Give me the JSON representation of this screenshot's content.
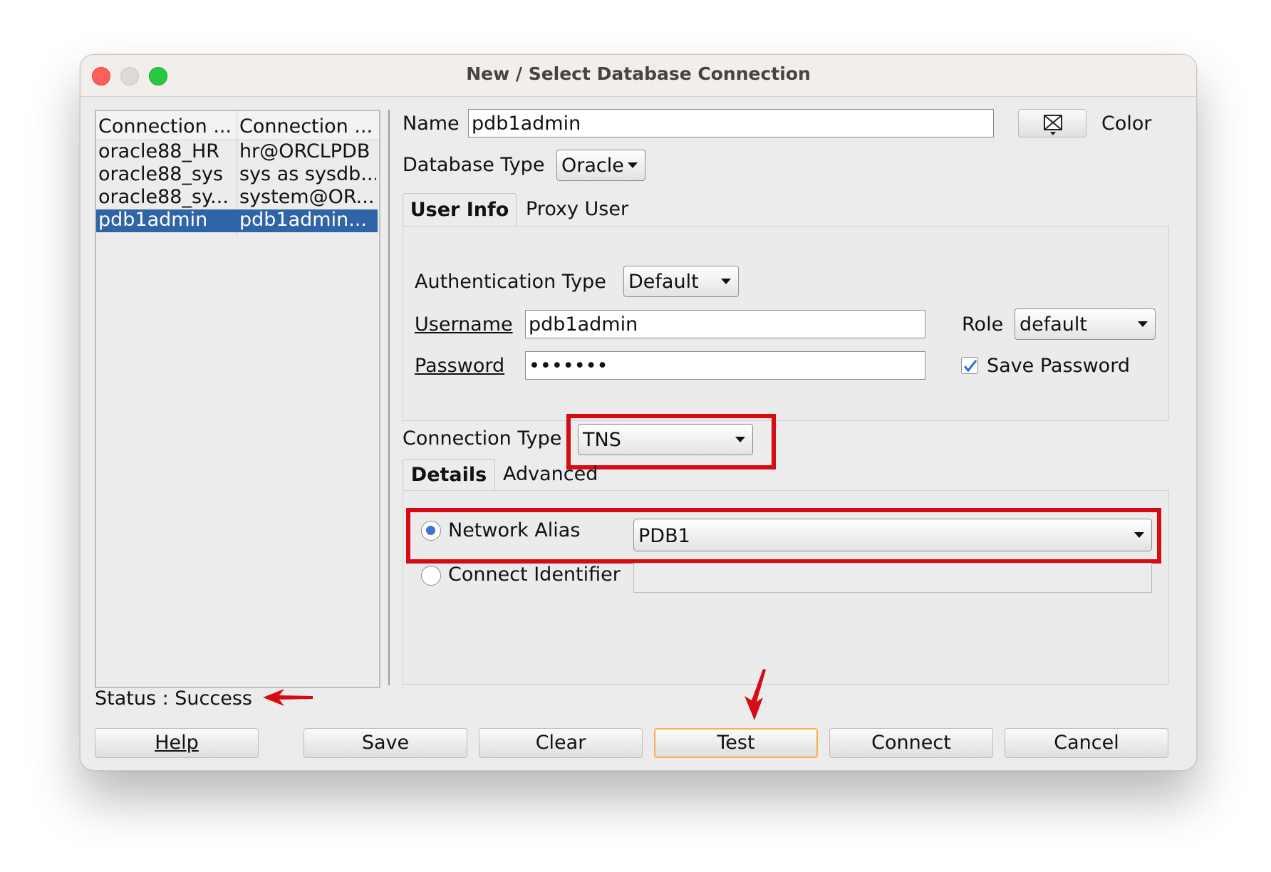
{
  "window": {
    "title": "New / Select Database Connection"
  },
  "connections": {
    "columns": [
      "Connection ...",
      "Connection ..."
    ],
    "rows": [
      {
        "name": "oracle88_HR",
        "details": "hr@ORCLPDB"
      },
      {
        "name": "oracle88_sys",
        "details": "sys as sysdb..."
      },
      {
        "name": "oracle88_sy...",
        "details": "system@OR..."
      },
      {
        "name": "pdb1admin",
        "details": "pdb1admin...",
        "selected": true
      }
    ]
  },
  "form": {
    "name_label": "Name",
    "name_value": "pdb1admin",
    "color_label": "Color",
    "db_type_label": "Database Type",
    "db_type_value": "Oracle",
    "tabs": [
      "User Info",
      "Proxy User"
    ],
    "auth_type_label": "Authentication Type",
    "auth_type_value": "Default",
    "username_label": "Username",
    "username_value": "pdb1admin",
    "password_label": "Password",
    "password_value": "•••••••",
    "role_label": "Role",
    "role_value": "default",
    "save_password_label": "Save Password",
    "save_password_checked": true,
    "conn_type_label": "Connection Type",
    "conn_type_value": "TNS",
    "detail_tabs": [
      "Details",
      "Advanced"
    ],
    "network_alias_label": "Network Alias",
    "network_alias_value": "PDB1",
    "connect_identifier_label": "Connect Identifier",
    "connect_identifier_value": ""
  },
  "status": {
    "text": "Status : Success"
  },
  "buttons": {
    "help": "Help",
    "save": "Save",
    "clear": "Clear",
    "test": "Test",
    "connect": "Connect",
    "cancel": "Cancel"
  },
  "annotations": {
    "highlight_color": "#d60b14"
  }
}
